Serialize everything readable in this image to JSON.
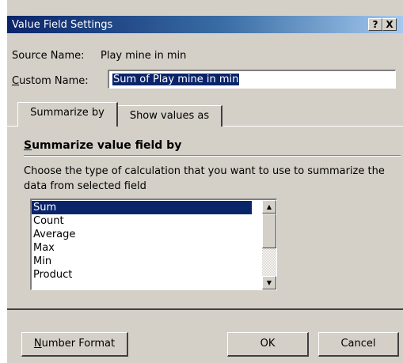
{
  "dialog": {
    "title": "Value Field Settings",
    "help_button": "?",
    "close_button": "X"
  },
  "source": {
    "label": "Source Name:",
    "value": "Play mine in min"
  },
  "custom": {
    "label_accel": "C",
    "label_rest": "ustom Name:",
    "value": "Sum of Play mine in min"
  },
  "tabs": [
    {
      "label": "Summarize by",
      "active": true
    },
    {
      "label": "Show values as",
      "active": false
    }
  ],
  "summarize": {
    "heading_accel": "S",
    "heading_rest": "ummarize value field by",
    "description": "Choose the type of calculation that you want to use to summarize the data from selected field",
    "items": [
      "Sum",
      "Count",
      "Average",
      "Max",
      "Min",
      "Product"
    ],
    "selected": "Sum"
  },
  "buttons": {
    "number_format_accel": "N",
    "number_format_rest": "umber Format",
    "ok": "OK",
    "cancel": "Cancel"
  },
  "colors": {
    "dialog_bg": "#d4d0c8",
    "title_start": "#0a246a",
    "title_end": "#a6caf0",
    "selection": "#0a246a"
  }
}
